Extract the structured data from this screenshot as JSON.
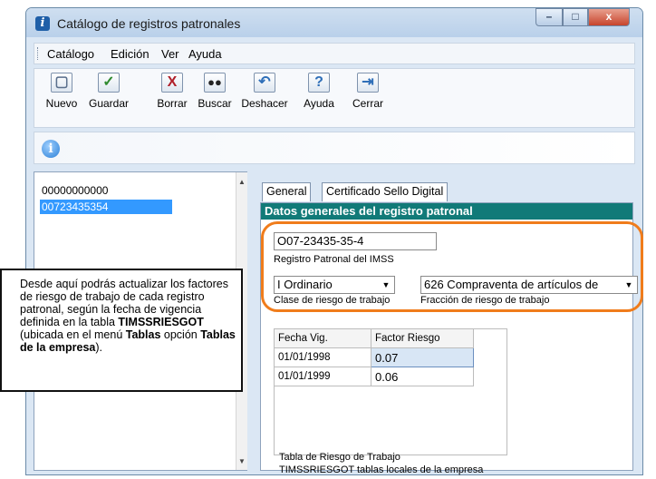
{
  "window": {
    "title": "Catálogo de registros patronales",
    "controls": {
      "minimize": "–",
      "maximize": "□",
      "close": "x"
    }
  },
  "menu": [
    {
      "label": "Catálogo"
    },
    {
      "label": "Edición"
    },
    {
      "label": "Ver"
    },
    {
      "label": "Ayuda"
    }
  ],
  "toolbar": [
    {
      "label": "Nuevo",
      "icon": "new-doc-icon"
    },
    {
      "label": "Guardar",
      "icon": "checkmark-icon"
    },
    {
      "label": "Borrar",
      "icon": "delete-x-icon"
    },
    {
      "label": "Buscar",
      "icon": "binoculars-icon"
    },
    {
      "label": "Deshacer",
      "icon": "undo-icon"
    },
    {
      "label": "Ayuda",
      "icon": "help-icon"
    },
    {
      "label": "Cerrar",
      "icon": "exit-icon"
    }
  ],
  "list": {
    "items": [
      "00000000000",
      "00723435354"
    ],
    "selected_index": 1
  },
  "callout": {
    "text_1": "Desde aquí podrás actualizar los factores de riesgo de trabajo de cada registro patronal, según la fecha de vigencia definida en la tabla ",
    "bold_1": "TIMSSRIESGOT",
    "text_2": " (ubicada en el menú ",
    "bold_2": "Tablas",
    "text_3": " opción ",
    "bold_3": "Tablas de la empresa",
    "text_4": ")."
  },
  "tabs": [
    {
      "label": "General",
      "active": true
    },
    {
      "label": "Certificado Sello Digital",
      "active": false
    }
  ],
  "section": {
    "title": "Datos generales del registro patronal"
  },
  "form": {
    "registro_value": "O07-23435-35-4",
    "registro_label": "Registro Patronal del IMSS",
    "clase_value": "I Ordinario",
    "clase_label": "Clase de riesgo de trabajo",
    "fraccion_value": "626 Compraventa de artículos de",
    "fraccion_label": "Fracción de riesgo de trabajo"
  },
  "grid": {
    "headers": [
      "Fecha Vig.",
      "Factor Riesgo"
    ],
    "rows": [
      [
        "01/01/1998",
        "0.07"
      ],
      [
        "01/01/1999",
        "0.06"
      ]
    ]
  },
  "footer": {
    "line1": "Tabla de Riesgo de Trabajo",
    "line2": "TIMSSRIESGOT tablas locales de la empresa"
  },
  "colors": {
    "section_header": "#117a78",
    "highlight_box": "#f07c1b",
    "selection": "#3399ff"
  }
}
